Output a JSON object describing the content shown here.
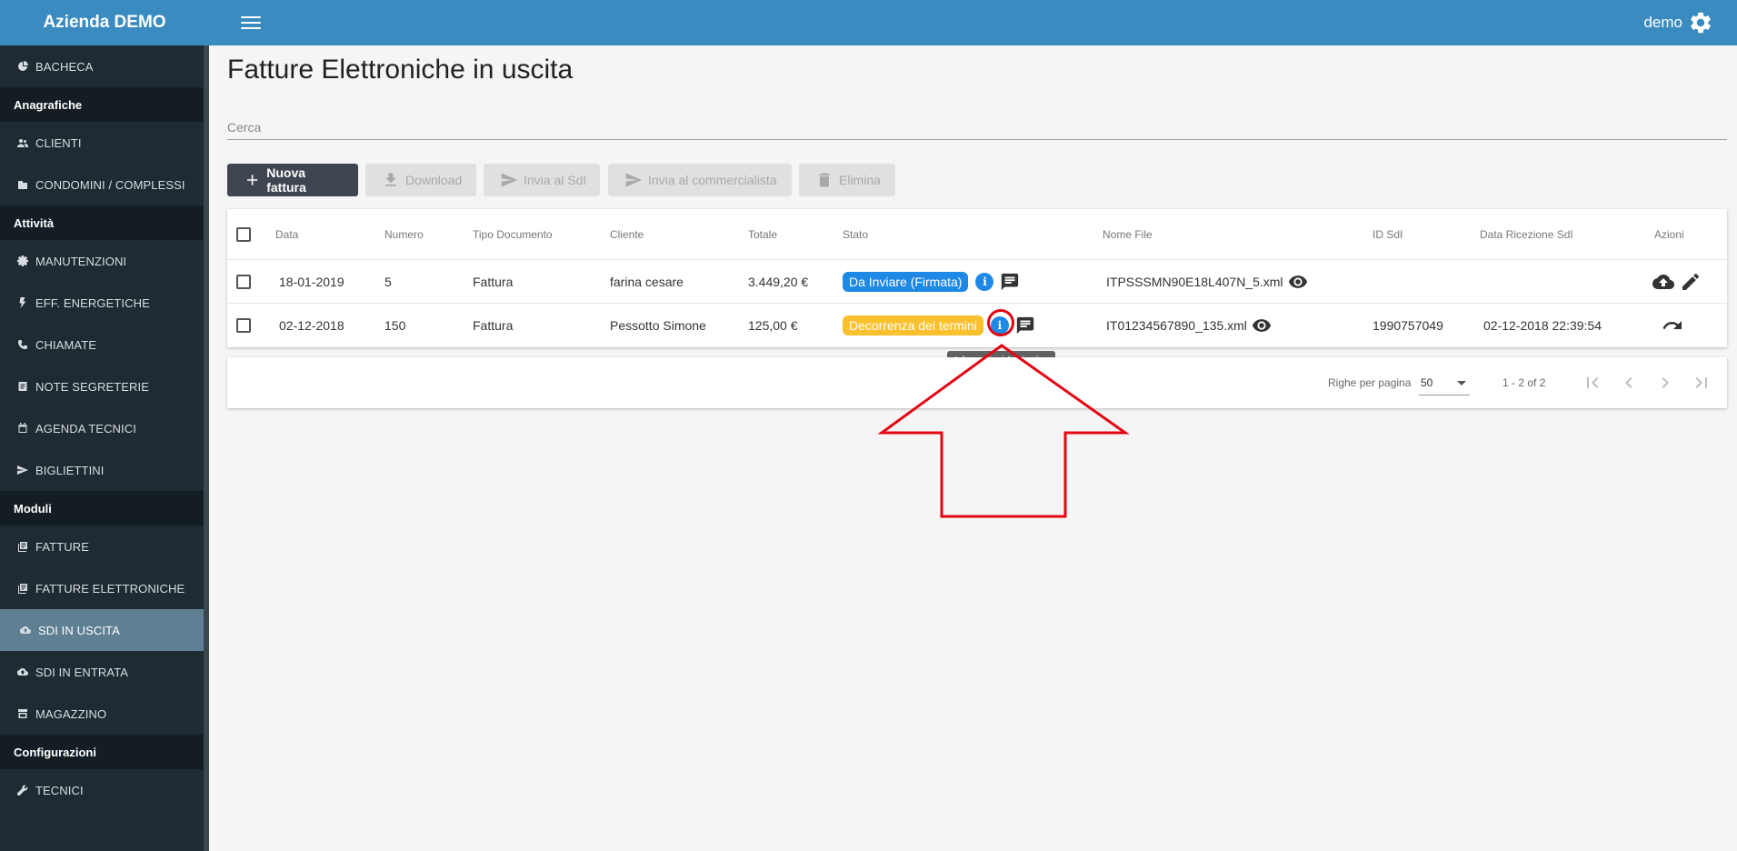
{
  "app": {
    "brand": "Azienda DEMO",
    "user": "demo"
  },
  "sidebar": {
    "items": [
      {
        "type": "item",
        "label": "BACHECA",
        "icon": "dashboard-icon"
      },
      {
        "type": "section",
        "label": "Anagrafiche"
      },
      {
        "type": "item",
        "label": "CLIENTI",
        "icon": "people-icon"
      },
      {
        "type": "item",
        "label": "CONDOMINI / COMPLESSI",
        "icon": "building-icon"
      },
      {
        "type": "section",
        "label": "Attività"
      },
      {
        "type": "item",
        "label": "MANUTENZIONI",
        "icon": "gear-icon"
      },
      {
        "type": "item",
        "label": "EFF. ENERGETICHE",
        "icon": "bolt-icon"
      },
      {
        "type": "item",
        "label": "CHIAMATE",
        "icon": "phone-icon"
      },
      {
        "type": "item",
        "label": "NOTE SEGRETERIE",
        "icon": "note-icon"
      },
      {
        "type": "item",
        "label": "AGENDA TECNICI",
        "icon": "calendar-icon"
      },
      {
        "type": "item",
        "label": "BIGLIETTINI",
        "icon": "send-icon"
      },
      {
        "type": "section",
        "label": "Moduli"
      },
      {
        "type": "item",
        "label": "FATTURE",
        "icon": "library-icon"
      },
      {
        "type": "item",
        "label": "FATTURE ELETTRONICHE",
        "icon": "library-icon"
      },
      {
        "type": "item",
        "label": "SDI IN USCITA",
        "icon": "cloud-upload-icon",
        "active": true
      },
      {
        "type": "item",
        "label": "SDI IN ENTRATA",
        "icon": "cloud-upload-icon"
      },
      {
        "type": "item",
        "label": "MAGAZZINO",
        "icon": "store-icon"
      },
      {
        "type": "section",
        "label": "Configurazioni"
      },
      {
        "type": "item",
        "label": "TECNICI",
        "icon": "wrench-icon"
      }
    ]
  },
  "main": {
    "title": "Fatture Elettroniche in uscita",
    "search_placeholder": "Cerca",
    "toolbar": {
      "new_invoice": "Nuova fattura",
      "download": "Download",
      "send_sdi": "Invia al SdI",
      "send_accountant": "Invia al commercialista",
      "delete": "Elimina"
    },
    "table": {
      "columns": [
        "Data",
        "Numero",
        "Tipo Documento",
        "Cliente",
        "Totale",
        "Stato",
        "Nome File",
        "ID SdI",
        "Data Ricezione SdI",
        "Azioni"
      ],
      "rows": [
        {
          "data": "18-01-2019",
          "numero": "5",
          "tipo": "Fattura",
          "cliente": "farina cesare",
          "totale": "3.449,20 €",
          "stato": "Da Inviare (Firmata)",
          "stato_color": "#1e88e5",
          "file": "ITPSSSMN90E18L407N_5.xml",
          "id_sdi": "",
          "data_ricezione": ""
        },
        {
          "data": "02-12-2018",
          "numero": "150",
          "tipo": "Fattura",
          "cliente": "Pessotto Simone",
          "totale": "125,00 €",
          "stato": "Decorrenza dei termini",
          "stato_color": "#fbc02d",
          "file": "IT01234567890_135.xml",
          "id_sdi": "1990757049",
          "data_ricezione": "02-12-2018 22:39:54"
        }
      ]
    },
    "tooltip": "Informazioni Aggiuntive",
    "pagination": {
      "rows_label": "Righe per pagina",
      "rows_value": "50",
      "range": "1 - 2 of 2"
    }
  },
  "colors": {
    "accent": "#3a8bbf",
    "sidebar": "#1f2b33",
    "annotation": "#e30613"
  }
}
